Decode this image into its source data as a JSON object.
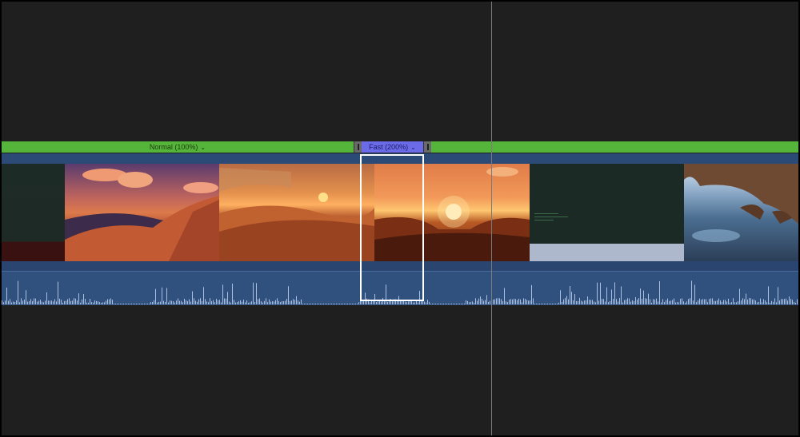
{
  "retime": {
    "normal_label": "Normal (100%)",
    "fast_label": "Fast (200%)",
    "dropdown_glyph": "⌄"
  },
  "colors": {
    "normal_speed": "#55b43a",
    "fast_speed": "#6b6be8",
    "clip_body": "#2a4670",
    "background": "#1f1f1f"
  },
  "clip": {
    "thumbnails": [
      "dark-scene",
      "desert-dusk",
      "desert-sunrise",
      "desert-sunset",
      "terminal-screen",
      "ocean-cave"
    ]
  },
  "icons": {
    "retime_handle": "retime-handle-icon",
    "dropdown": "chevron-down-icon"
  }
}
